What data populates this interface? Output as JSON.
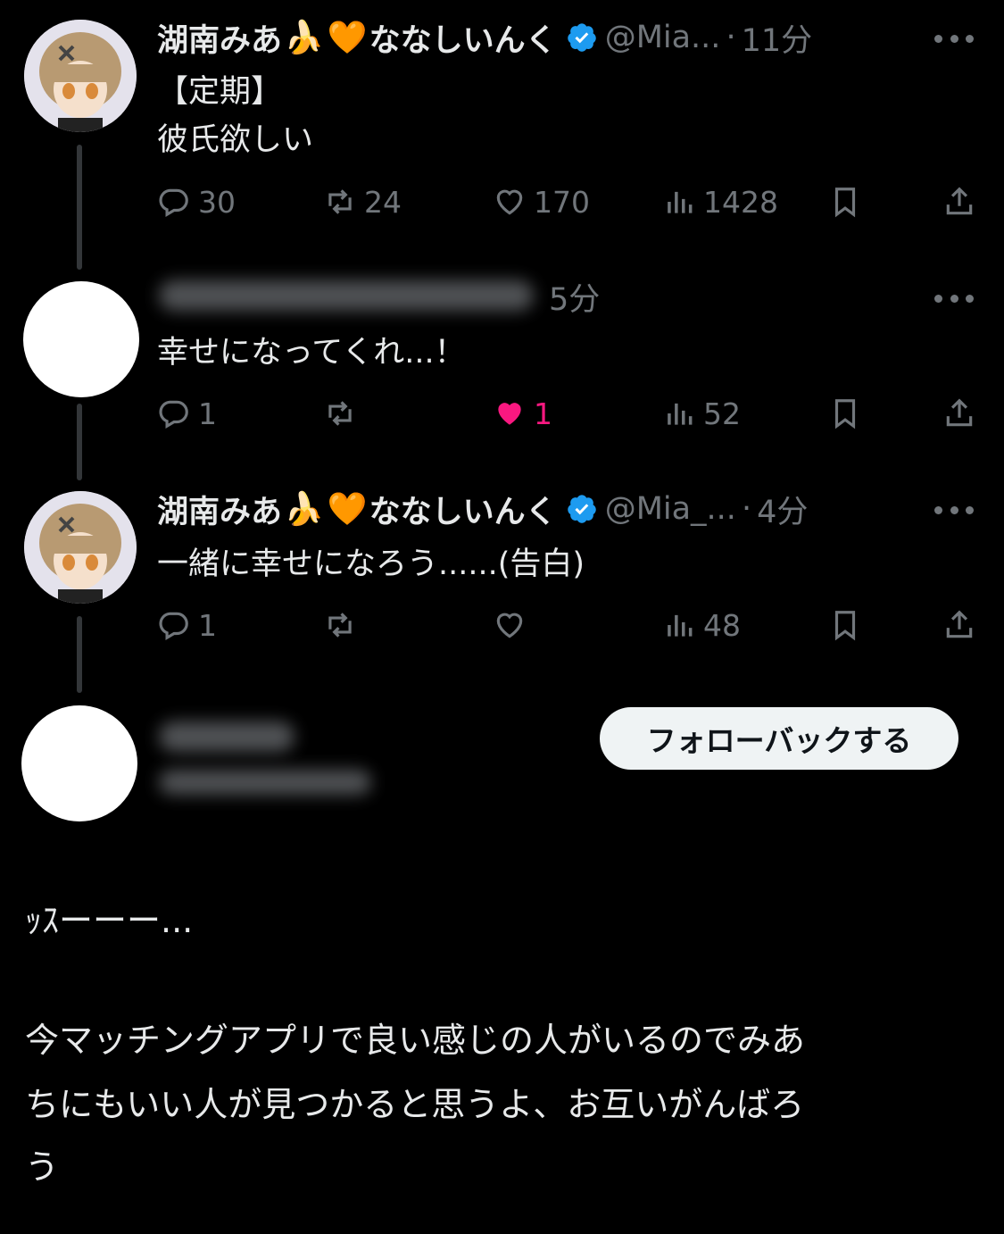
{
  "posts": [
    {
      "display_name": "湖南みあ",
      "emoji_1": "🍌",
      "emoji_2": "🧡",
      "display_name_2": "ななしいんく",
      "handle": "@Mia...",
      "dot": "·",
      "time": "11分",
      "text_line_1": "【定期】",
      "text_line_2": "彼氏欲しい",
      "replies": "30",
      "reposts": "24",
      "likes": "170",
      "views": "1428"
    },
    {
      "time": "5分",
      "text_line_1": "幸せになってくれ...！",
      "replies": "1",
      "reposts": "",
      "likes": "1",
      "views": "52",
      "like_color": "#f91880"
    },
    {
      "display_name": "湖南みあ",
      "emoji_1": "🍌",
      "emoji_2": "🧡",
      "display_name_2": "ななしいんく",
      "handle": "@Mia_...",
      "dot": "·",
      "time": "4分",
      "text_line_1": "一緒に幸せになろう......(告白)",
      "replies": "1",
      "reposts": "",
      "likes": "",
      "views": "48"
    }
  ],
  "follow_button": "フォローバックする",
  "caption": {
    "line_1": "ｯｽーーー...",
    "line_2": "今マッチングアプリで良い感じの人がいるのでみあ",
    "line_3": "ちにもいい人が見つかると思うよ、お互いがんばろ",
    "line_4": "う"
  },
  "colors": {
    "background": "#000000",
    "text": "#e7e9ea",
    "muted": "#71767b",
    "verified": "#1d9bf0",
    "like_active": "#f91880"
  }
}
